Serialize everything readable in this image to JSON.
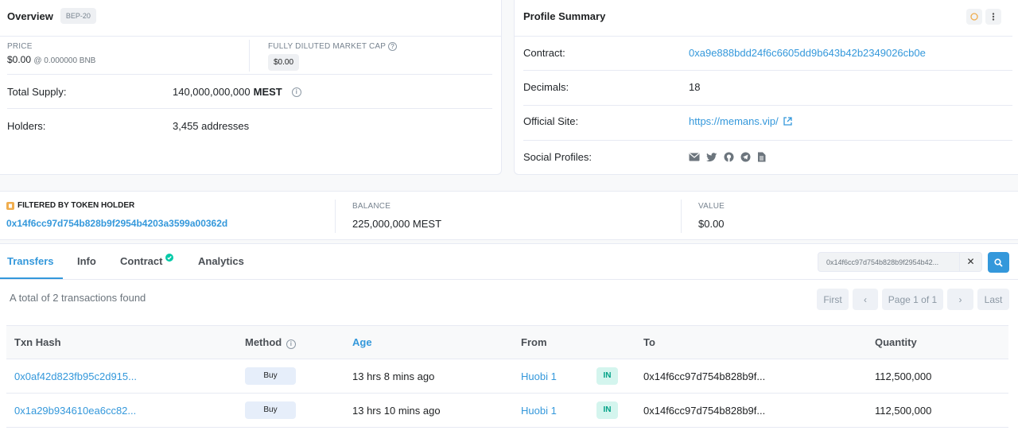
{
  "overview": {
    "title": "Overview",
    "badge": "BEP-20",
    "price_label": "PRICE",
    "price_value": "$0.00",
    "price_bnb": "@ 0.000000 BNB",
    "fdmc_label": "FULLY DILUTED MARKET CAP",
    "fdmc_value": "$0.00",
    "total_supply_label": "Total Supply:",
    "total_supply_value": "140,000,000,000",
    "total_supply_symbol": "MEST",
    "holders_label": "Holders:",
    "holders_value": "3,455 addresses"
  },
  "profile": {
    "title": "Profile Summary",
    "contract_label": "Contract:",
    "contract_value": "0xa9e888bdd24f6c6605dd9b643b42b2349026cb0e",
    "decimals_label": "Decimals:",
    "decimals_value": "18",
    "site_label": "Official Site:",
    "site_value": "https://memans.vip/",
    "social_label": "Social Profiles:",
    "social_icons": [
      "envelope-icon",
      "twitter-icon",
      "github-icon",
      "telegram-icon",
      "document-icon"
    ]
  },
  "filter": {
    "label": "FILTERED BY TOKEN HOLDER",
    "address": "0x14f6cc97d754b828b9f2954b4203a3599a00362d",
    "balance_label": "BALANCE",
    "balance_value": "225,000,000 MEST",
    "value_label": "VALUE",
    "value_value": "$0.00"
  },
  "tabs": [
    "Transfers",
    "Info",
    "Contract",
    "Analytics"
  ],
  "search": {
    "value": "0x14f6cc97d754b828b9f2954b42..."
  },
  "summary": "A total of 2 transactions found",
  "pager": {
    "first": "First",
    "page": "Page 1 of 1",
    "last": "Last"
  },
  "table": {
    "headers": [
      "Txn Hash",
      "Method",
      "Age",
      "From",
      "To",
      "Quantity"
    ],
    "rows": [
      {
        "hash": "0x0af42d823fb95c2d915...",
        "method": "Buy",
        "age": "13 hrs 8 mins ago",
        "from": "Huobi 1",
        "dir": "IN",
        "to": "0x14f6cc97d754b828b9f...",
        "qty": "112,500,000"
      },
      {
        "hash": "0x1a29b934610ea6cc82...",
        "method": "Buy",
        "age": "13 hrs 10 mins ago",
        "from": "Huobi 1",
        "dir": "IN",
        "to": "0x14f6cc97d754b828b9f...",
        "qty": "112,500,000"
      }
    ]
  },
  "colors": {
    "accent": "#3498db",
    "in_badge": "#00a186",
    "warning": "#f0ad4e"
  }
}
